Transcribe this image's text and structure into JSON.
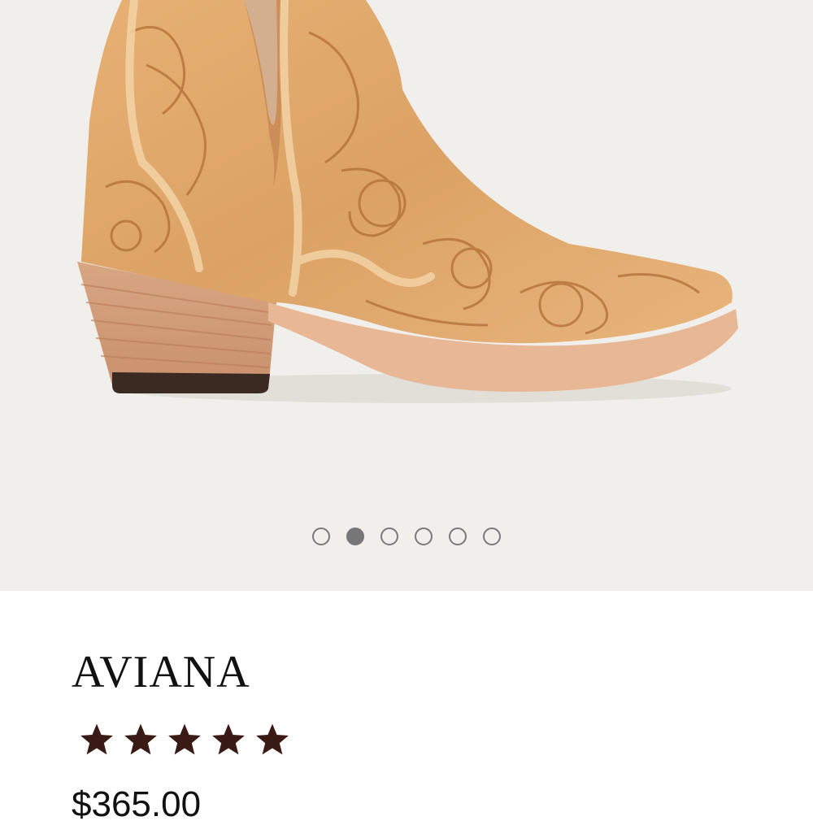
{
  "product": {
    "name": "AVIANA",
    "rating": 5,
    "rating_max": 5,
    "price": "$365.00"
  },
  "gallery": {
    "slide_count": 6,
    "active_slide": 2
  },
  "colors": {
    "gallery_bg": "#f1efec",
    "leather": "#e2ab6e",
    "star": "#3a1a14",
    "dot_active": "#777777"
  },
  "icons": {
    "star": "star-icon"
  }
}
